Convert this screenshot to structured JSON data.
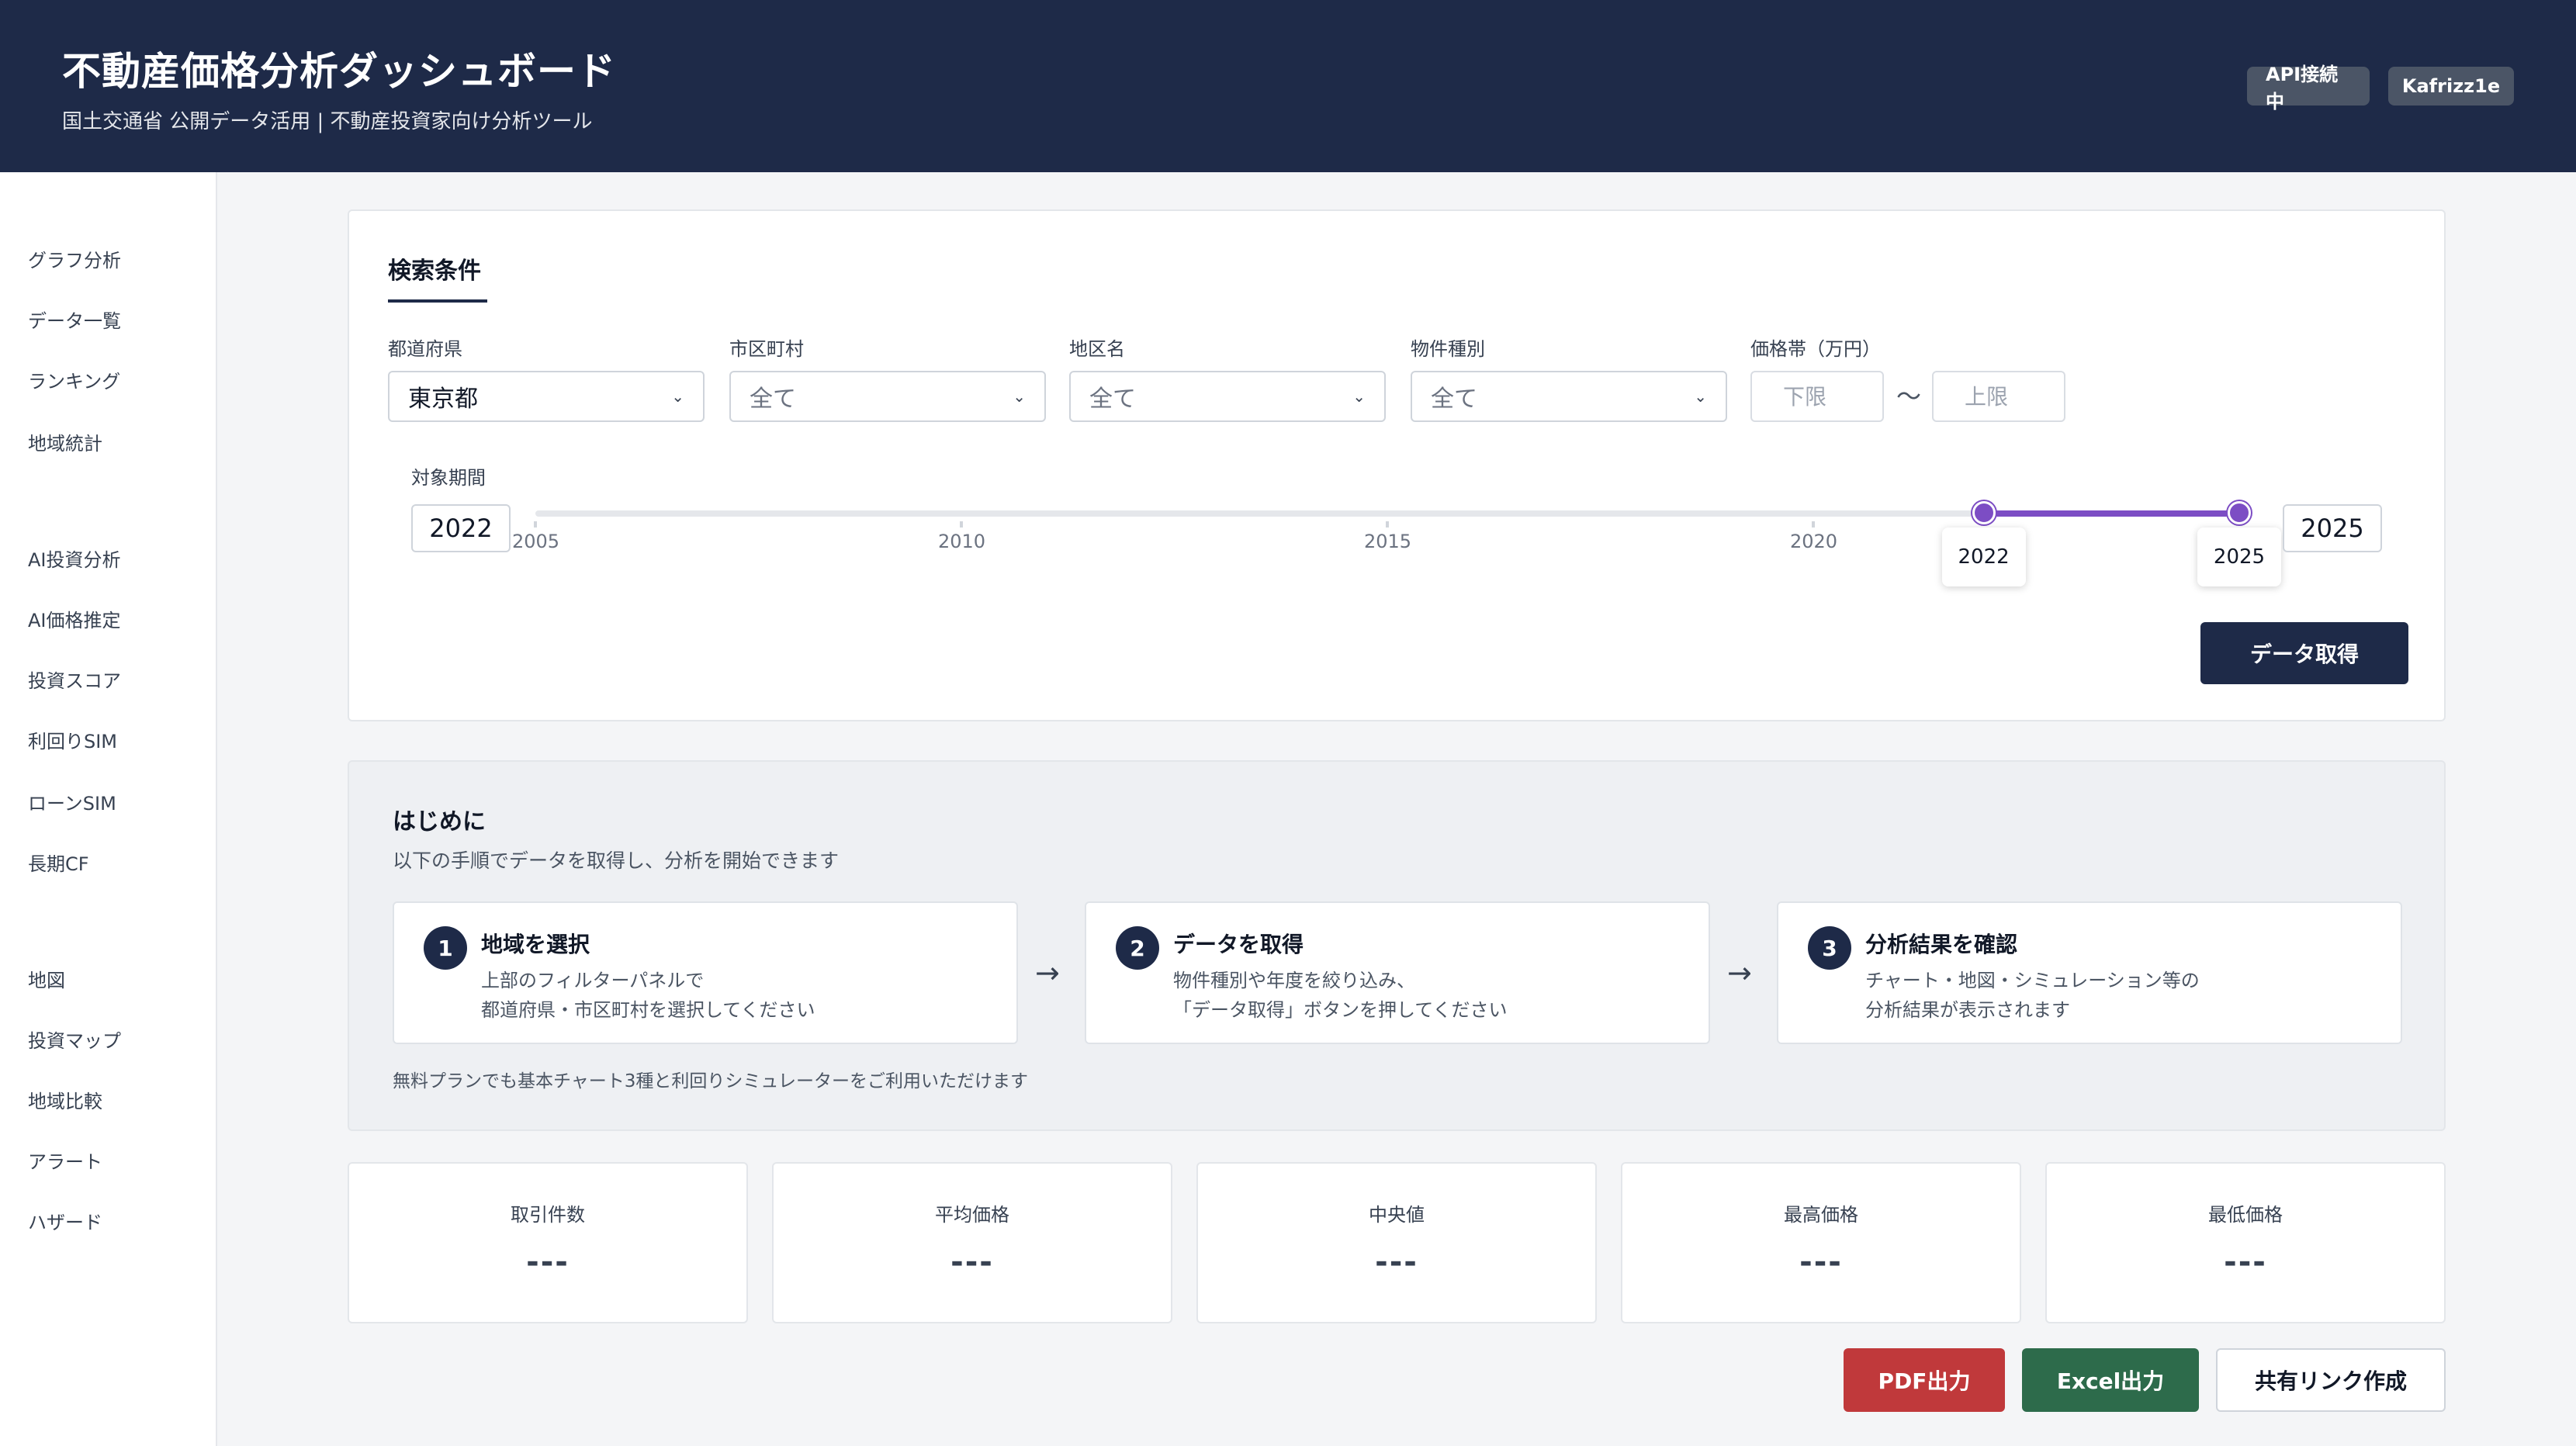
{
  "header": {
    "title": "不動産価格分析ダッシュボード",
    "subtitle": "国土交通省 公開データ活用 | 不動産投資家向け分析ツール",
    "api_status": "API接続中",
    "user": "Kafrizz1e"
  },
  "sidebar": {
    "groups": [
      [
        "グラフ分析",
        "データ一覧",
        "ランキング",
        "地域統計"
      ],
      [
        "AI投資分析",
        "AI価格推定",
        "投資スコア",
        "利回りSIM",
        "ローンSIM",
        "長期CF"
      ],
      [
        "地図",
        "投資マップ",
        "地域比較",
        "アラート",
        "ハザード"
      ]
    ]
  },
  "search": {
    "title": "検索条件",
    "prefecture": {
      "label": "都道府県",
      "value": "東京都"
    },
    "city": {
      "label": "市区町村",
      "value": "全て"
    },
    "district": {
      "label": "地区名",
      "value": "全て"
    },
    "property_type": {
      "label": "物件種別",
      "value": "全て"
    },
    "price_range": {
      "label": "価格帯（万円）",
      "min_placeholder": "下限",
      "max_placeholder": "上限",
      "separator": "〜"
    },
    "period": {
      "label": "対象期間",
      "start": "2022",
      "end": "2025",
      "min": 2005,
      "max": 2025,
      "ticks": [
        "2005",
        "2010",
        "2015",
        "2020"
      ]
    },
    "fetch_button": "データ取得"
  },
  "intro": {
    "title": "はじめに",
    "description": "以下の手順でデータを取得し、分析を開始できます",
    "steps": [
      {
        "num": "1",
        "title": "地域を選択",
        "line1": "上部のフィルターパネルで",
        "line2": "都道府県・市区町村を選択してください"
      },
      {
        "num": "2",
        "title": "データを取得",
        "line1": "物件種別や年度を絞り込み、",
        "line2": "「データ取得」ボタンを押してください"
      },
      {
        "num": "3",
        "title": "分析結果を確認",
        "line1": "チャート・地図・シミュレーション等の",
        "line2": "分析結果が表示されます"
      }
    ],
    "arrow": "→",
    "note": "無料プランでも基本チャート3種と利回りシミュレーターをご利用いただけます"
  },
  "stats": [
    {
      "label": "取引件数",
      "value": "---"
    },
    {
      "label": "平均価格",
      "value": "---"
    },
    {
      "label": "中央値",
      "value": "---"
    },
    {
      "label": "最高価格",
      "value": "---"
    },
    {
      "label": "最低価格",
      "value": "---"
    }
  ],
  "export": {
    "pdf": "PDF出力",
    "excel": "Excel出力",
    "share": "共有リンク作成"
  },
  "colors": {
    "header_bg": "#1e2a48",
    "slider_accent": "#7c4dc4",
    "pdf_button": "#c0393b",
    "excel_button": "#2d6b4b"
  }
}
